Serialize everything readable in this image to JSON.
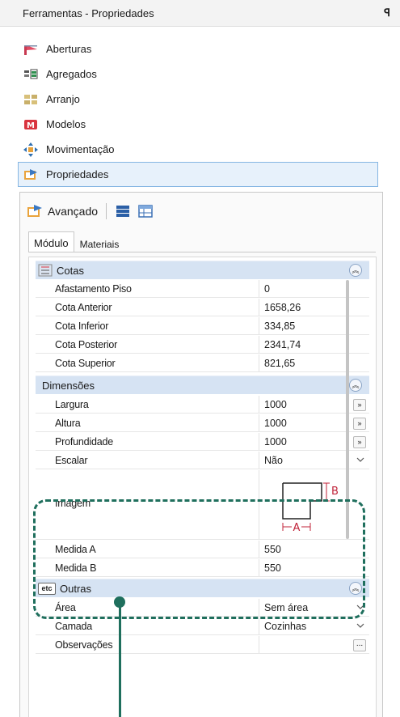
{
  "window": {
    "title": "Ferramentas - Propriedades",
    "pin_glyph": "ꟼ"
  },
  "nav": {
    "items": [
      {
        "label": "Aberturas",
        "icon": "door-opening-icon"
      },
      {
        "label": "Agregados",
        "icon": "aggregates-icon"
      },
      {
        "label": "Arranjo",
        "icon": "arrangement-icon"
      },
      {
        "label": "Modelos",
        "icon": "models-icon"
      },
      {
        "label": "Movimentação",
        "icon": "move-arrows-icon"
      },
      {
        "label": "Propriedades",
        "icon": "properties-icon",
        "selected": true
      }
    ]
  },
  "panel": {
    "header_label": "Avançado",
    "tabs": [
      {
        "label": "Módulo",
        "active": true
      },
      {
        "label": "Materiais",
        "active": false
      }
    ]
  },
  "grid": {
    "cotas": {
      "label": "Cotas",
      "rows": [
        {
          "name": "Afastamento Piso",
          "value": "0"
        },
        {
          "name": "Cota Anterior",
          "value": "1658,26"
        },
        {
          "name": "Cota Inferior",
          "value": "334,85"
        },
        {
          "name": "Cota Posterior",
          "value": "2341,74"
        },
        {
          "name": "Cota Superior",
          "value": "821,65"
        }
      ]
    },
    "dimensoes": {
      "label": "Dimensões",
      "rows": [
        {
          "name": "Largura",
          "value": "1000",
          "button": "»"
        },
        {
          "name": "Altura",
          "value": "1000",
          "button": "»"
        },
        {
          "name": "Profundidade",
          "value": "1000",
          "button": "»"
        },
        {
          "name": "Escalar",
          "value": "Não"
        },
        {
          "name": "Imagem"
        },
        {
          "name": "Medida A",
          "value": "550"
        },
        {
          "name": "Medida B",
          "value": "550"
        }
      ],
      "image_labels": {
        "a": "A",
        "b": "B"
      }
    },
    "outras": {
      "label": "Outras",
      "icon_text": "etc",
      "rows": [
        {
          "name": "Área",
          "value": "Sem área"
        },
        {
          "name": "Camada",
          "value": "Cozinhas"
        },
        {
          "name": "Observações",
          "value": "",
          "button": "..."
        }
      ]
    },
    "collapse_glyph": "︽"
  },
  "colors": {
    "highlight": "#1f6f5d",
    "category_bg": "#d6e3f3",
    "selection": "#e7f1fb",
    "dim_red": "#c0233a"
  }
}
